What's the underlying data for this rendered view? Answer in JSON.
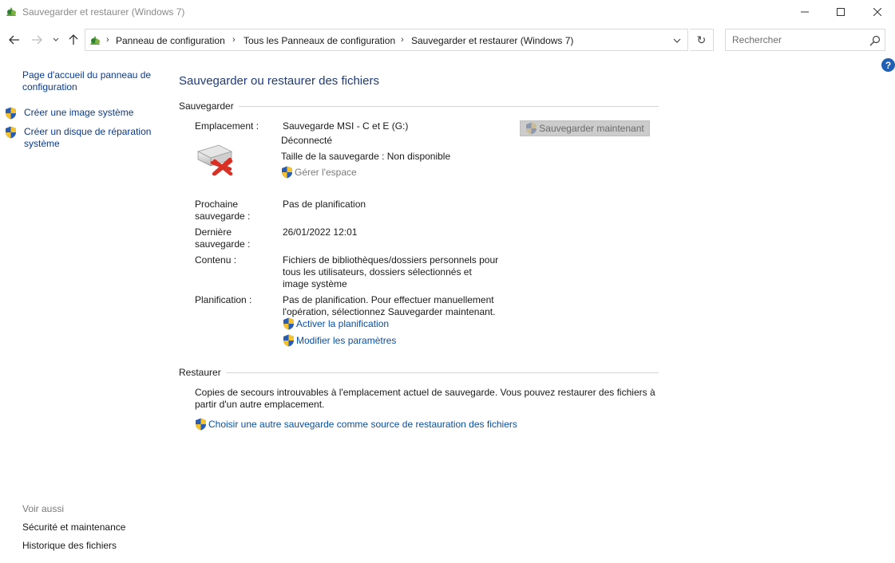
{
  "window": {
    "title": "Sauvegarder et restaurer (Windows 7)",
    "icon": "control-panel-icon",
    "controls": {
      "minimize": "minimize-icon",
      "maximize": "maximize-icon",
      "close": "close-icon"
    }
  },
  "nav": {
    "breadcrumb": [
      "Panneau de configuration",
      "Tous les Panneaux de configuration",
      "Sauvegarder et restaurer (Windows 7)"
    ],
    "search_placeholder": "Rechercher"
  },
  "sidebar": {
    "home_link": "Page d'accueil du panneau de configuration",
    "items": [
      {
        "label": "Créer une image système",
        "icon": "uac-shield-icon"
      },
      {
        "label": "Créer un disque de réparation système",
        "icon": "uac-shield-icon"
      }
    ],
    "see_also": "Voir aussi",
    "see_also_links": [
      "Sécurité et maintenance",
      "Historique des fichiers"
    ]
  },
  "main": {
    "title": "Sauvegarder ou restaurer des fichiers",
    "backup": {
      "heading": "Sauvegarder",
      "location_label": "Emplacement :",
      "location_value": "Sauvegarde MSI - C et E (G:)",
      "status": "Déconnecté",
      "size": "Taille de la sauvegarde : Non disponible",
      "manage_space": "Gérer l'espace",
      "backup_now_button": "Sauvegarder maintenant",
      "next_backup_label": "Prochaine sauvegarde :",
      "next_backup_value": "Pas de planification",
      "last_backup_label": "Dernière sauvegarde :",
      "last_backup_value": "26/01/2022 12:01",
      "contents_label": "Contenu :",
      "contents_value": "Fichiers de bibliothèques/dossiers personnels pour tous les utilisateurs, dossiers sélectionnés et image système",
      "schedule_label": "Planification :",
      "schedule_value": "Pas de planification. Pour effectuer manuellement l'opération, sélectionnez Sauvegarder maintenant.",
      "enable_schedule": "Activer la planification",
      "change_settings": "Modifier les paramètres"
    },
    "restore": {
      "heading": "Restaurer",
      "text": "Copies de secours introuvables à l'emplacement actuel de sauvegarde. Vous pouvez restaurer des fichiers à partir d'un autre emplacement.",
      "choose_other": "Choisir une autre sauvegarde comme source de restauration des fichiers"
    }
  },
  "colors": {
    "link": "#0a3a8c",
    "title": "#1e3a7a",
    "help": "#1f5fb4",
    "error_x": "#d93025"
  }
}
